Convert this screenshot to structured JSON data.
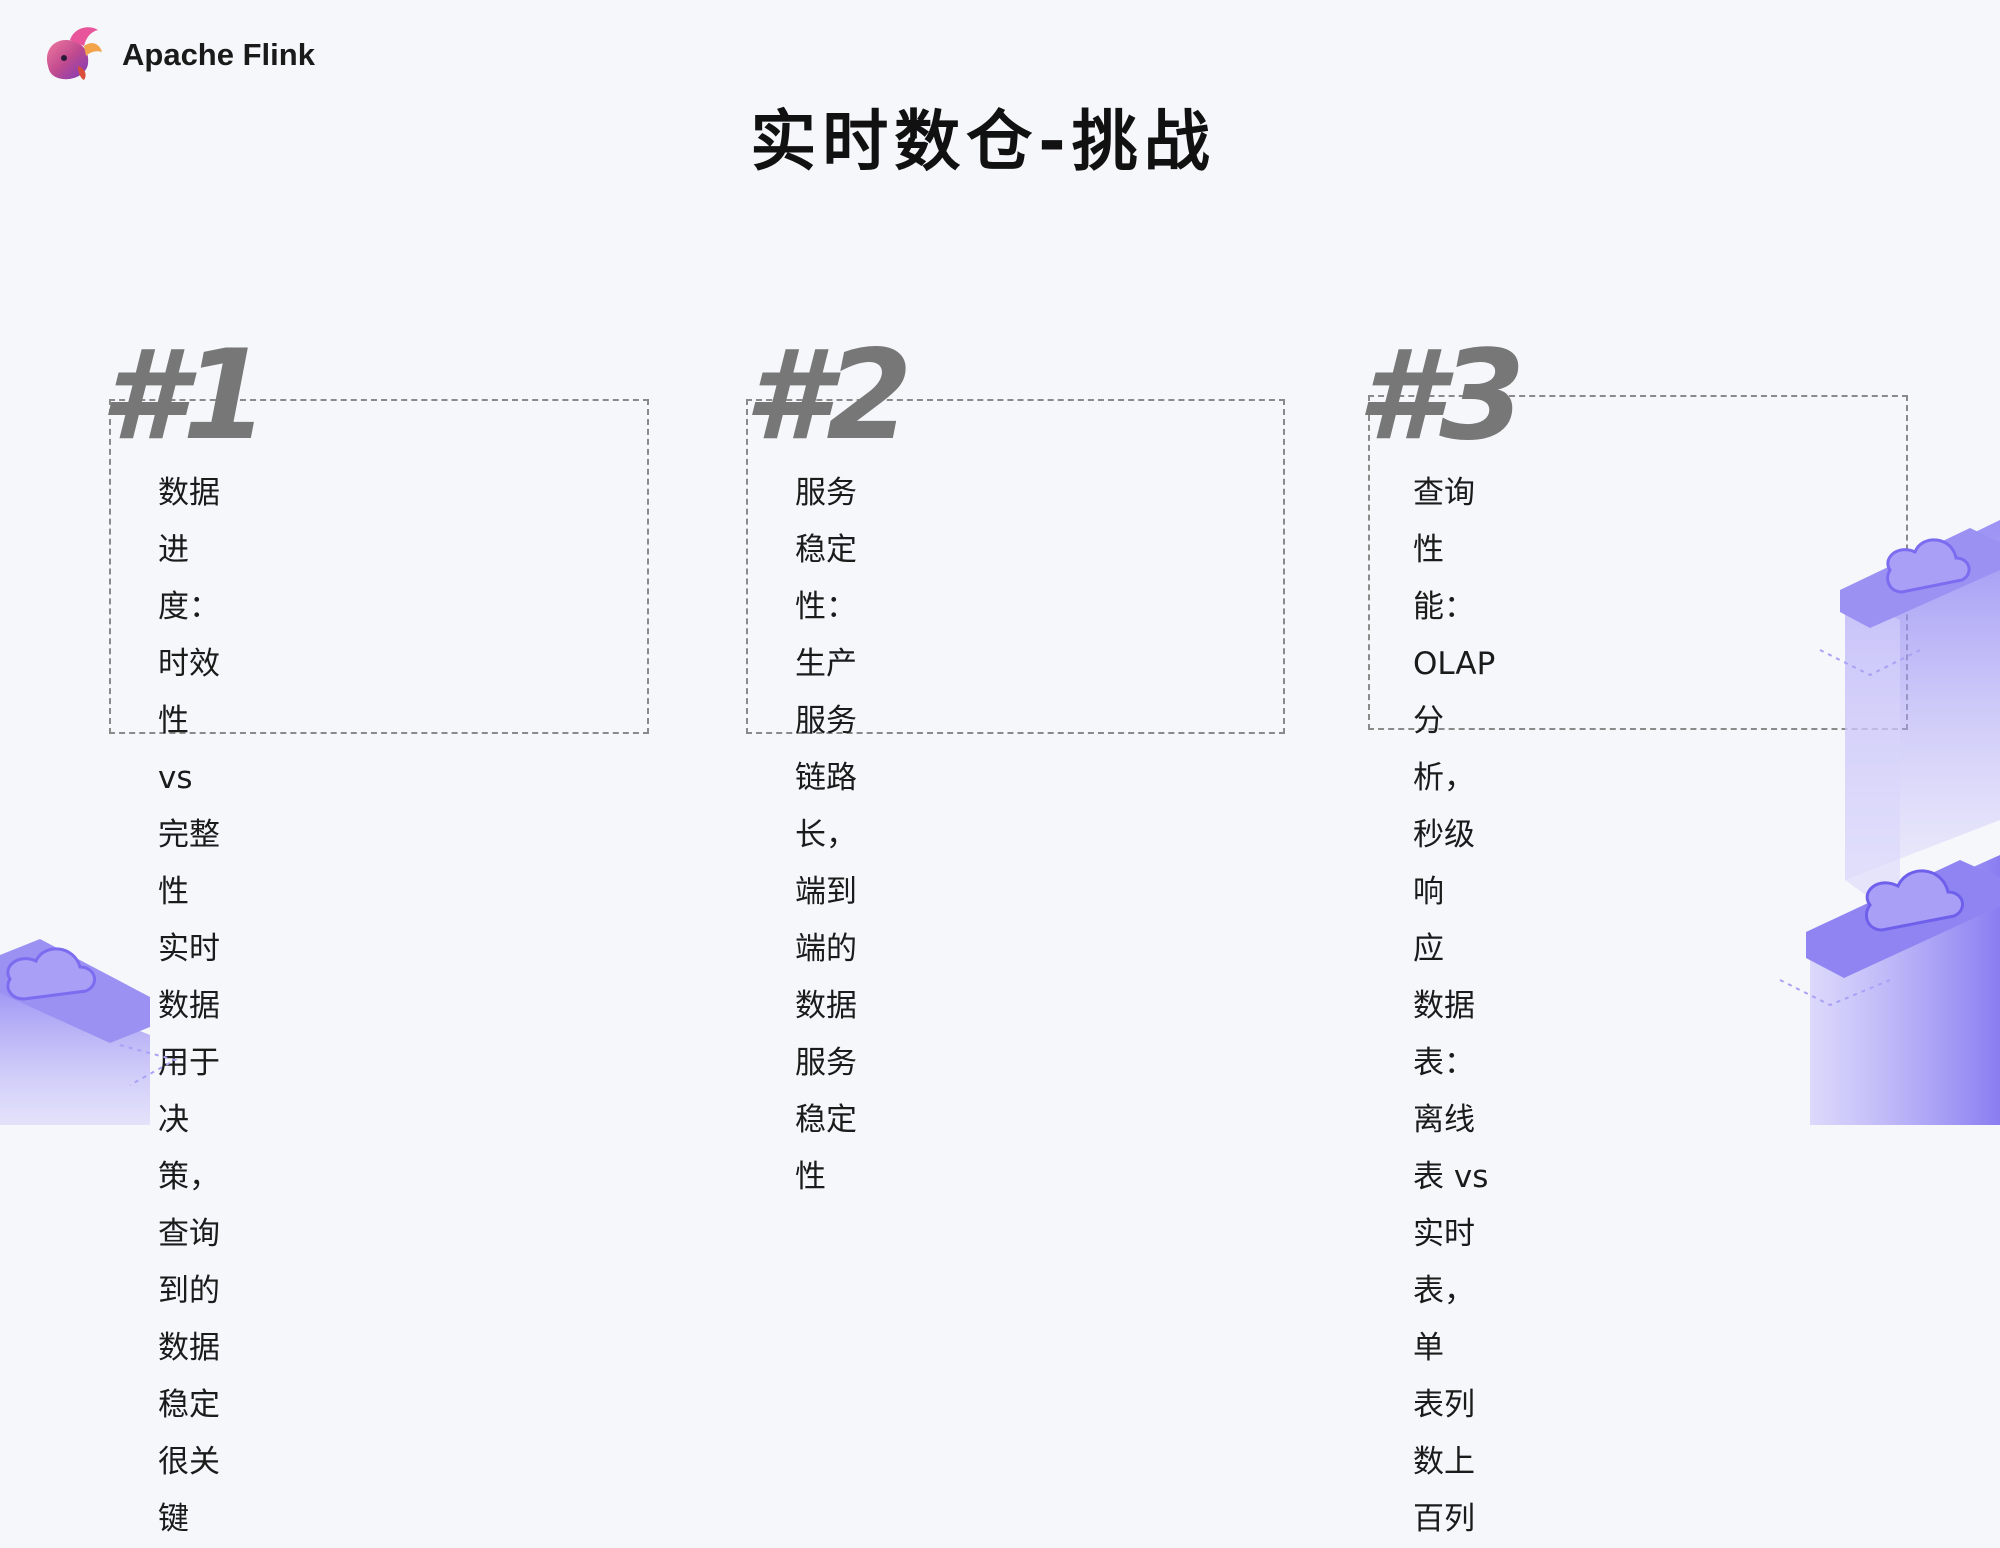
{
  "header": {
    "logo_text": "Apache Flink",
    "logo_icon": "flink-squirrel-icon"
  },
  "title": "实时数仓-挑战",
  "cards": [
    {
      "number": "#1",
      "lines": [
        "数据进度：时效性 vs 完整性",
        "实时数据用于决策，查询到的",
        "数据稳定很关键"
      ]
    },
    {
      "number": "#2",
      "lines": [
        "服务稳定性：生产服务链路长，",
        "端到端的数据服务稳定性"
      ]
    },
    {
      "number": "#3",
      "lines": [
        "查询性能：OLAP分析，秒级响",
        "应",
        "数据表：离线表 vs 实时表，单",
        "表列数上百列"
      ]
    }
  ],
  "decoration": {
    "icon": "isometric-cloud-server-icon",
    "accent": "#7b6cf0",
    "accent_light": "#b9b2f7"
  }
}
